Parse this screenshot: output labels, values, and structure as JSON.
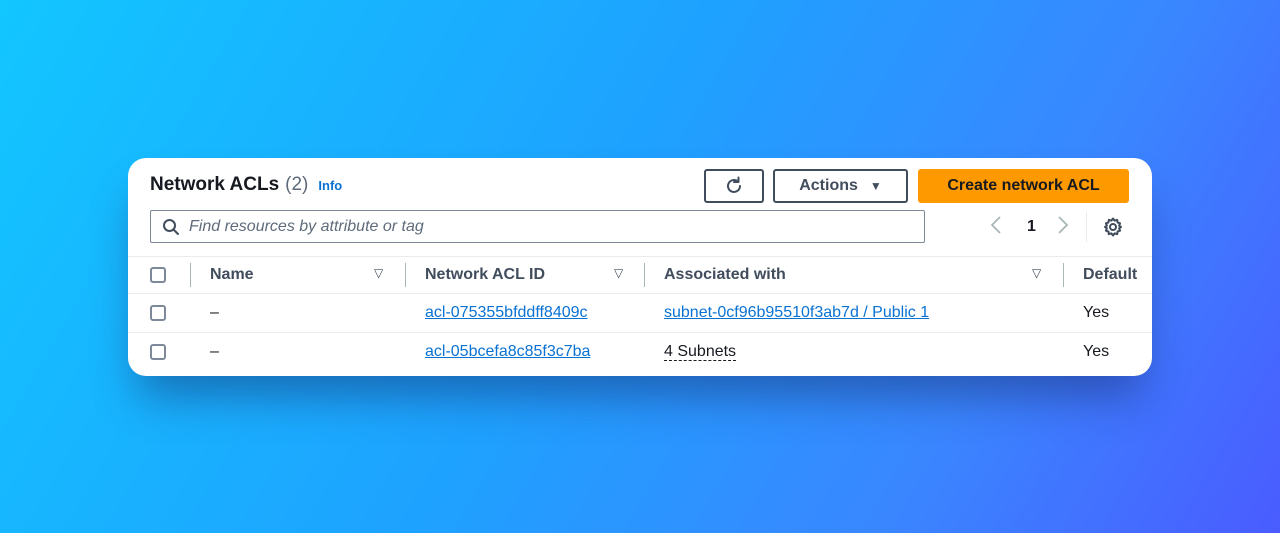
{
  "panel": {
    "title": "Network ACLs",
    "count": "(2)",
    "info_label": "Info"
  },
  "toolbar": {
    "refresh_icon": "refresh-icon",
    "actions_label": "Actions",
    "create_label": "Create network ACL",
    "create_color": "#ff9900"
  },
  "search": {
    "placeholder": "Find resources by attribute or tag"
  },
  "pagination": {
    "current_page": "1"
  },
  "table": {
    "columns": [
      "Name",
      "Network ACL ID",
      "Associated with",
      "Default"
    ],
    "rows": [
      {
        "name": "–",
        "acl_id": "acl-075355bfddff8409c",
        "associated": "subnet-0cf96b95510f3ab7d / Public 1",
        "default": "Yes"
      },
      {
        "name": "–",
        "acl_id": "acl-05bcefa8c85f3c7ba",
        "associated": "4 Subnets",
        "default": "Yes"
      }
    ]
  }
}
